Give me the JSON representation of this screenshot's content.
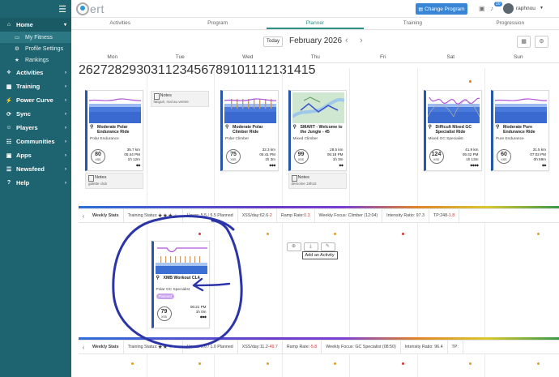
{
  "sidebar": {
    "items": [
      {
        "icon": "home-icon",
        "glyph": "⌂",
        "label": "Home",
        "expanded": true
      },
      {
        "icon": "activities-icon",
        "glyph": "⟡",
        "label": "Activities"
      },
      {
        "icon": "training-icon",
        "glyph": "▦",
        "label": "Training"
      },
      {
        "icon": "power-curve-icon",
        "glyph": "⚡",
        "label": "Power Curve"
      },
      {
        "icon": "sync-icon",
        "glyph": "⟳",
        "label": "Sync"
      },
      {
        "icon": "players-icon",
        "glyph": "☺",
        "label": "Players"
      },
      {
        "icon": "communities-icon",
        "glyph": "☷",
        "label": "Communities"
      },
      {
        "icon": "apps-icon",
        "glyph": "▣",
        "label": "Apps"
      },
      {
        "icon": "newsfeed-icon",
        "glyph": "☰",
        "label": "Newsfeed"
      },
      {
        "icon": "help-icon",
        "glyph": "?",
        "label": "Help"
      }
    ],
    "home_sub": [
      {
        "icon": "fitness-icon",
        "glyph": "▭",
        "label": "My Fitness",
        "active": true
      },
      {
        "icon": "profile-settings-icon",
        "glyph": "⚙",
        "label": "Profile Settings"
      },
      {
        "icon": "rankings-icon",
        "glyph": "★",
        "label": "Rankings"
      }
    ]
  },
  "topbar": {
    "logo_text": "ert",
    "change_program": "Change Program",
    "notification_count": "20",
    "username": "raphnou"
  },
  "tabs": [
    "Activities",
    "Program",
    "Planner",
    "Training",
    "Progression"
  ],
  "active_tab": "Planner",
  "calendar": {
    "today_label": "Today",
    "month": "February 2026",
    "days_of_week": [
      "Mon",
      "Tue",
      "Wed",
      "Thu",
      "Fri",
      "Sat",
      "Sun"
    ],
    "week1_dates": [
      "26",
      "27",
      "28",
      "29",
      "30",
      "31",
      "1"
    ],
    "week2_dates": [
      "2",
      "3",
      "4",
      "5",
      "6",
      "7",
      "8"
    ],
    "week3_dates": [
      "9",
      "10",
      "11",
      "12",
      "13",
      "14",
      "15"
    ]
  },
  "week1": {
    "cards": [
      {
        "title": "Moderate Polar Endurance Ride",
        "subtitle": "Polar Endurance",
        "xss": "80",
        "distance": "35.7 km",
        "time": "05:44 PM",
        "duration": "1h 12m",
        "difficulty": "◆◆"
      },
      {
        "title": "Moderate Polar Climber Ride",
        "subtitle": "Polar Climber",
        "xss": "75",
        "distance": "32.3 km",
        "time": "05:41 PM",
        "duration": "1h 3m",
        "difficulty": "◆◆◆"
      },
      {
        "title": "SMART - Welcome to the Jungle - 45",
        "subtitle": "Mixed Climber",
        "xss": "99",
        "distance": "28.5 km",
        "time": "05:18 PM",
        "duration": "1h 3m",
        "difficulty": "◆◆"
      },
      {
        "title": "Difficult Mixed GC Specialist Ride",
        "subtitle": "Mixed GC Specialist",
        "xss": "124",
        "distance": "41.9 km",
        "time": "05:42 PM",
        "duration": "1h 13m",
        "difficulty": "◆◆◆◆"
      },
      {
        "title": "Moderate Pure Endurance Ride",
        "subtitle": "Pure Endurance",
        "xss": "60",
        "distance": "31.5 km",
        "time": "07:02 PM",
        "duration": "0h 59m",
        "difficulty": "◆◆"
      }
    ],
    "notes": [
      {
        "title": "Notes",
        "body": "fatigué, mal au ventre"
      },
      {
        "title": "Notes",
        "body": "galette club"
      },
      {
        "title": "Notes",
        "body": "demoine 18h15"
      }
    ],
    "stats": {
      "title": "Weekly Stats",
      "training_status": "Training Status:",
      "hours": "Hours: 5.5 / 5.5 Planned",
      "xss_day_label": "XSS/day:",
      "xss_day": "62.6",
      "xss_delta": "-2",
      "ramp_label": "Ramp Rate:",
      "ramp": "0.3",
      "focus": "Weekly Focus: Climber (12:04)",
      "intensity": "Intensity Ratio: 97.3",
      "tp_label": "TP:",
      "tp": "248",
      "tp_delta": "-1.8",
      "stars_on": 3
    }
  },
  "week2": {
    "card": {
      "title": "XMB Workout CL4",
      "subtitle": "Polar GC Specialist",
      "status": "Planned",
      "xss": "79",
      "time": "06:21 PM",
      "duration": "1h 0m",
      "difficulty": "◆◆◆"
    },
    "tooltip": "Add an Activity",
    "stats": {
      "title": "Weekly Stats",
      "training_status": "Training Status:",
      "hours": "Hours: 0.0 / 1.0 Planned",
      "xss_day_label": "XSS/day:",
      "xss_day": "11.2",
      "xss_delta": "-49.7",
      "ramp_label": "Ramp Rate:",
      "ramp": "-5.8",
      "focus": "Weekly Focus: GC Specialist (08:50)",
      "intensity": "Intensity Ratio: 96.4",
      "tp_label": "TP:",
      "stars_on": 2
    }
  },
  "colors": {
    "sidebar": "#1e6470",
    "accent": "#2e8f89",
    "button": "#3a86d6",
    "card_edge": "#2857a8",
    "annotation": "#2b35a8"
  }
}
